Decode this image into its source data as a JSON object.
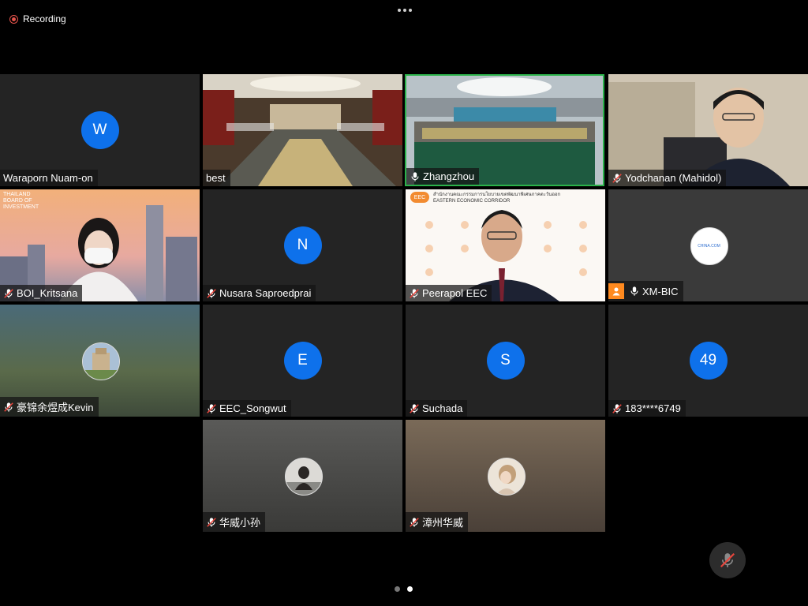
{
  "recording": {
    "label": "Recording"
  },
  "participants": [
    {
      "name": "Waraporn Nuam-on",
      "initial": "W"
    },
    {
      "name": "best"
    },
    {
      "name": "Zhangzhou"
    },
    {
      "name": "Yodchanan (Mahidol)"
    },
    {
      "name": "BOI_Kritsana",
      "logo_text": "THAILAND BOARD OF INVESTMENT"
    },
    {
      "name": "Nusara Saproedprai",
      "initial": "N"
    },
    {
      "name": "Peerapol EEC",
      "banner_text": "สำนักงานคณะกรรมการนโยบายเขตพัฒนาพิเศษภาคตะวันออก",
      "banner_sub": "EASTERN ECONOMIC CORRIDOR",
      "logo": "EEC"
    },
    {
      "name": "XM-BIC",
      "logo_text": "CHINA.COM"
    },
    {
      "name": "豪锦余煜成Kevin"
    },
    {
      "name": "EEC_Songwut",
      "initial": "E"
    },
    {
      "name": "Suchada",
      "initial": "S"
    },
    {
      "name": "183****6749",
      "initial": "49"
    },
    {
      "name": "华威小孙"
    },
    {
      "name": "漳州华威"
    }
  ],
  "colors": {
    "avatar_blue": "#0e71eb",
    "active_speaker": "#2bb24a",
    "recording_red": "#e5534b",
    "mute_red": "#e8453c",
    "badge_orange": "#ff8a1f"
  },
  "icons": {
    "more": "ellipsis-icon",
    "mic_on": "microphone-icon",
    "mic_off": "microphone-muted-icon",
    "mute_button": "microphone-muted-icon"
  },
  "pager": {
    "total": 2,
    "current": 2
  }
}
